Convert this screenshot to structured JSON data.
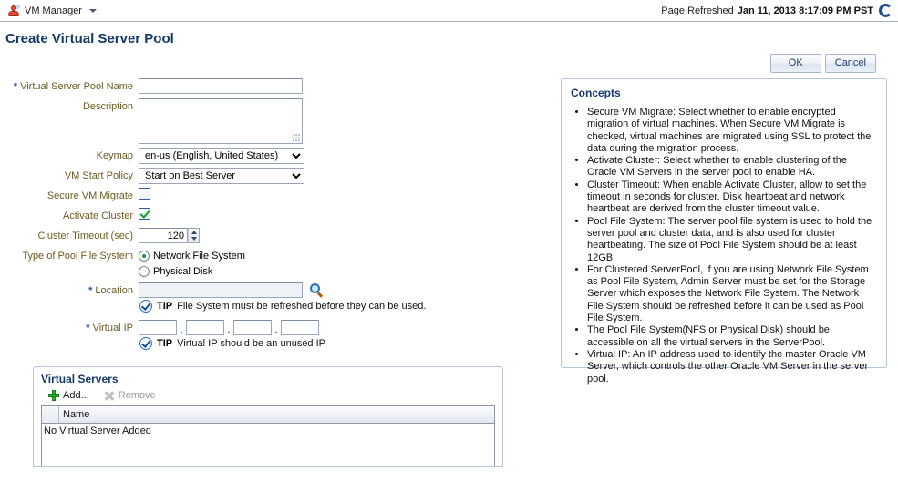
{
  "topbar": {
    "user_icon": "user-icon",
    "app_label": "VM Manager",
    "menu_caret": "chevron-down-icon",
    "refreshed_label": "Page Refreshed",
    "refreshed_time": "Jan 11, 2013 8:17:09 PM PST",
    "refresh_icon": "refresh-icon"
  },
  "page": {
    "title": "Create Virtual Server Pool"
  },
  "actions": {
    "ok_label": "OK",
    "cancel_label": "Cancel"
  },
  "form": {
    "pool_name": {
      "label": "Virtual Server Pool Name",
      "required": "*",
      "value": "",
      "placeholder": ""
    },
    "description": {
      "label": "Description",
      "value": ""
    },
    "keymap": {
      "label": "Keymap",
      "value": "en-us (English, United States)",
      "options": [
        "en-us (English, United States)"
      ]
    },
    "vm_start_policy": {
      "label": "VM Start Policy",
      "value": "Start on Best Server",
      "options": [
        "Start on Best Server"
      ]
    },
    "secure_vm_migrate": {
      "label": "Secure VM Migrate",
      "checked": false
    },
    "activate_cluster": {
      "label": "Activate Cluster",
      "checked": true
    },
    "cluster_timeout": {
      "label": "Cluster Timeout (sec)",
      "value": "120"
    },
    "pool_fs_type": {
      "label": "Type of Pool File System",
      "options": [
        {
          "label": "Network File System",
          "selected": true
        },
        {
          "label": "Physical Disk",
          "selected": false
        }
      ]
    },
    "location": {
      "label": "Location",
      "required": "*",
      "value": "",
      "search_icon": "search-icon"
    },
    "location_tip": {
      "icon": "tip-check-icon",
      "word": "TIP",
      "text": "File System must be refreshed before they can be used."
    },
    "virtual_ip": {
      "label": "Virtual IP",
      "required": "*",
      "octets": [
        "",
        "",
        "",
        ""
      ],
      "separator": "."
    },
    "virtual_ip_tip": {
      "icon": "tip-check-icon",
      "word": "TIP",
      "text": "Virtual IP should be an unused IP"
    }
  },
  "virtual_servers": {
    "title": "Virtual Servers",
    "toolbar": {
      "add_label": "Add...",
      "add_icon": "plus-icon",
      "remove_label": "Remove",
      "remove_icon": "remove-x-icon"
    },
    "columns": [
      "",
      "Name"
    ],
    "empty_text": "No Virtual Server Added",
    "rows": []
  },
  "concepts": {
    "title": "Concepts",
    "items": [
      "Secure VM Migrate: Select whether to enable encrypted migration of virtual machines. When Secure VM Migrate is checked, virtual machines are migrated using SSL to protect the data during the migration process.",
      "Activate Cluster: Select whether to enable clustering of the Oracle VM Servers in the server pool to enable HA.",
      "Cluster Timeout: When enable Activate Cluster, allow to set the timeout in seconds for cluster. Disk heartbeat and network heartbeat are derived from the cluster timeout value.",
      "Pool File System: The server pool file system is used to hold the server pool and cluster data, and is also used for cluster heartbeating. The size of Pool File System should be at least 12GB.",
      "For Clustered ServerPool, if you are using Network File System as Pool File System, Admin Server must be set for the Storage Server which exposes the Network File System. The Network File System should be refreshed before it can be used as Pool File System.",
      "The Pool File System(NFS or Physical Disk) should be accessible on all the virtual servers in the ServerPool.",
      "Virtual IP: An IP address used to identify the master Oracle VM Server, which controls the other Oracle VM Server in the server pool."
    ]
  },
  "colors": {
    "title_blue": "#15396b",
    "label_olive": "#6b5c23",
    "required_blue": "#2a56a8",
    "accent_green": "#12a02c",
    "panel_border": "#b4c4d9"
  }
}
